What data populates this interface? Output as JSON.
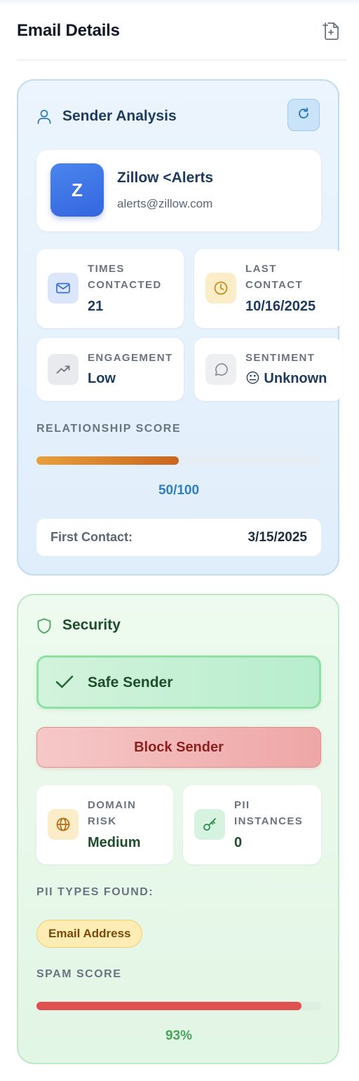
{
  "header": {
    "title": "Email Details",
    "export_icon": "file-export-icon"
  },
  "sender_analysis": {
    "title": "Sender Analysis",
    "icon": "user-icon",
    "refresh_icon": "refresh-icon",
    "profile": {
      "initial": "Z",
      "name": "Zillow <Alerts",
      "email": "alerts@zillow.com"
    },
    "stats": {
      "times_contacted": {
        "label": "Times Contacted",
        "value": "21",
        "icon": "mail-icon"
      },
      "last_contact": {
        "label": "Last Contact",
        "value": "10/16/2025",
        "icon": "clock-icon"
      },
      "engagement": {
        "label": "Engagement",
        "value": "Low",
        "icon": "trending-up-icon"
      },
      "sentiment": {
        "label": "Sentiment",
        "value": "😐 Unknown",
        "icon": "message-circle-icon"
      }
    },
    "relationship": {
      "label": "Relationship Score",
      "score_text": "50/100",
      "score": 50,
      "max": 100
    },
    "first_contact": {
      "label": "First Contact:",
      "value": "3/15/2025"
    }
  },
  "security": {
    "title": "Security",
    "icon": "shield-icon",
    "safe_label": "Safe Sender",
    "block_label": "Block Sender",
    "stats": {
      "domain_risk": {
        "label": "Domain Risk",
        "value": "Medium",
        "icon": "globe-icon"
      },
      "pii_instances": {
        "label": "PII Instances",
        "value": "0",
        "icon": "key-icon"
      }
    },
    "pii_types": {
      "label": "PII Types Found:",
      "items": [
        "Email Address"
      ]
    },
    "spam": {
      "label": "Spam Score",
      "score_text": "93%",
      "score": 93
    }
  },
  "colors": {
    "sender_accent": "#2f7fbf",
    "security_accent": "#4aa35c",
    "relationship_bar": "#d9832a",
    "spam_bar": "#df5151"
  }
}
